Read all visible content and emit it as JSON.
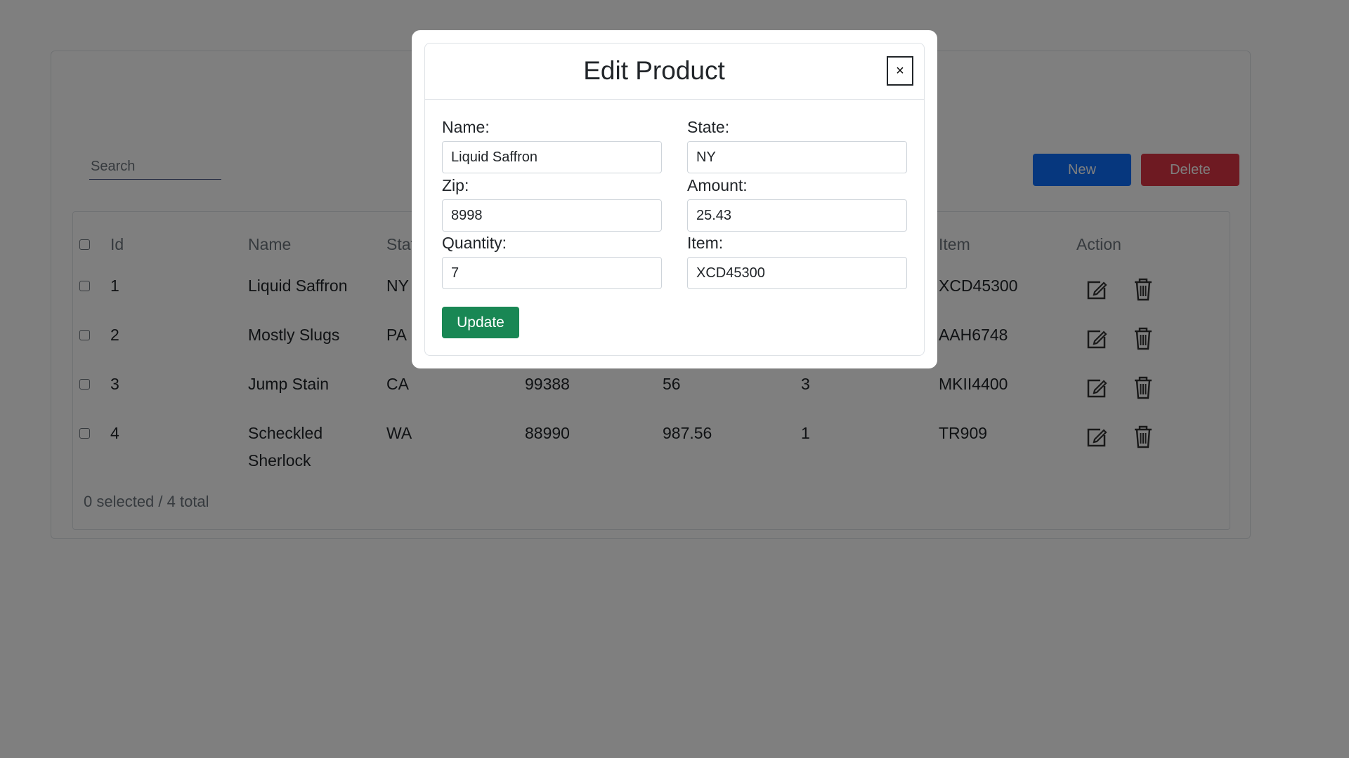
{
  "toolbar": {
    "search_placeholder": "Search",
    "new_label": "New",
    "delete_label": "Delete"
  },
  "table": {
    "headers": {
      "id": "Id",
      "name": "Name",
      "state": "State",
      "item": "Item",
      "action": "Action"
    },
    "rows": [
      {
        "id": "1",
        "name": "Liquid Saffron",
        "state": "NY",
        "zip": "",
        "amount": "",
        "quantity": "",
        "item": "XCD45300"
      },
      {
        "id": "2",
        "name": "Mostly Slugs",
        "state": "PA",
        "zip": "",
        "amount": "",
        "quantity": "",
        "item": "AAH6748"
      },
      {
        "id": "3",
        "name": "Jump Stain",
        "state": "CA",
        "zip": "99388",
        "amount": "56",
        "quantity": "3",
        "item": "MKII4400"
      },
      {
        "id": "4",
        "name": "Scheckled Sherlock",
        "state": "WA",
        "zip": "88990",
        "amount": "987.56",
        "quantity": "1",
        "item": "TR909"
      }
    ],
    "footer": "0 selected / 4 total"
  },
  "modal": {
    "title": "Edit Product",
    "close_label": "×",
    "name_label": "Name:",
    "name_value": "Liquid Saffron",
    "state_label": "State:",
    "state_value": "NY",
    "zip_label": "Zip:",
    "zip_value": "8998",
    "amount_label": "Amount:",
    "amount_value": "25.43",
    "quantity_label": "Quantity:",
    "quantity_value": "7",
    "item_label": "Item:",
    "item_value": "XCD45300",
    "update_label": "Update"
  },
  "icons": {
    "edit": "edit-icon",
    "trash": "trash-icon"
  },
  "colors": {
    "new_button": "#0d6efd",
    "delete_button": "#dc3545",
    "update_button": "#198754",
    "backdrop": "rgba(0,0,0,0.5)"
  }
}
